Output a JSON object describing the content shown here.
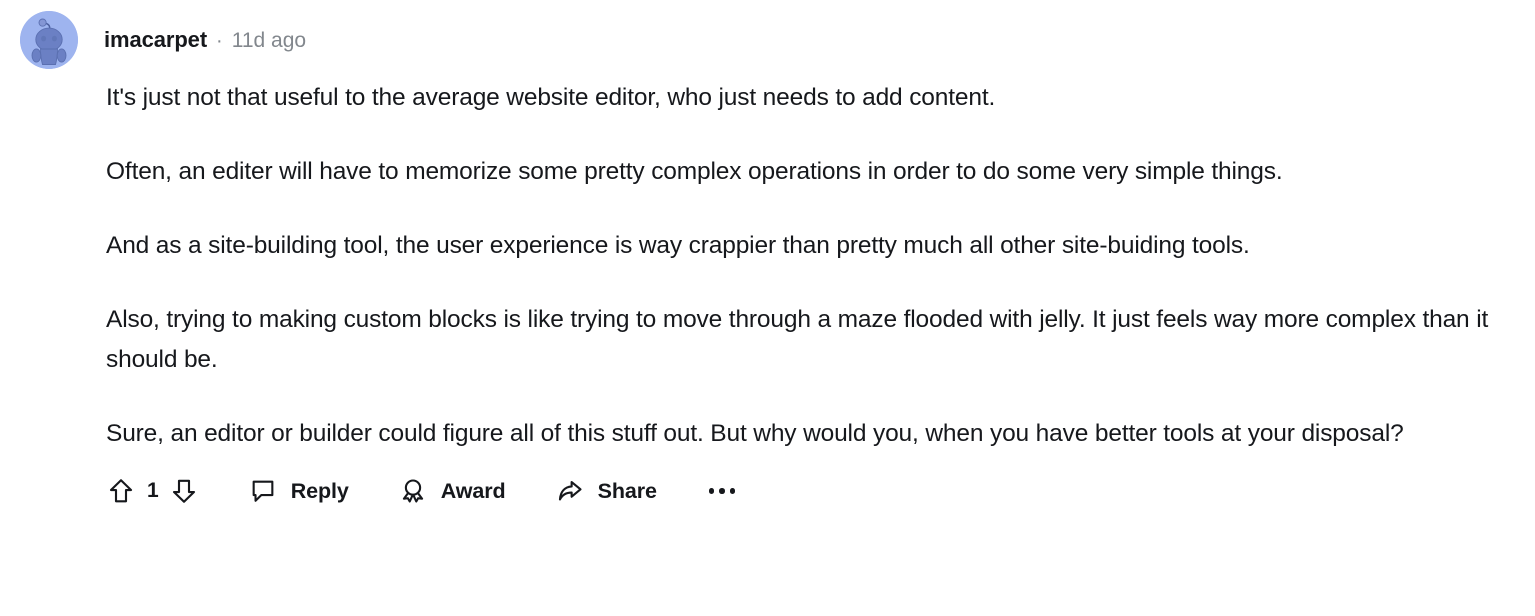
{
  "comment": {
    "author": {
      "username": "imacarpet",
      "avatar_icon": "reddit-snoo-avatar",
      "avatar_bg_color": "#9eb4ef",
      "avatar_fg_color": "#6b80c4"
    },
    "separator": "·",
    "timestamp": "11d ago",
    "paragraphs": [
      "It's just not that useful to the average website editor, who just needs to add content.",
      "Often, an editer will have to memorize some pretty complex operations in order to do some very simple things.",
      "And as a site-building tool, the user experience is way crappier than pretty much all other site-buiding tools.",
      "Also, trying to making custom blocks is like trying to move through a maze flooded with jelly. It just feels way more complex than it should be.",
      "Sure, an editor or builder could figure all of this stuff out. But why would you, when you have better tools at your disposal?"
    ],
    "actions": {
      "upvote_icon": "upvote-arrow-icon",
      "vote_count": "1",
      "downvote_icon": "downvote-arrow-icon",
      "reply_icon": "comment-bubble-icon",
      "reply_label": "Reply",
      "award_icon": "award-medal-icon",
      "award_label": "Award",
      "share_icon": "share-arrow-icon",
      "share_label": "Share",
      "overflow_icon": "more-options-icon"
    }
  },
  "colors": {
    "text": "#16181c",
    "muted": "#82878d",
    "background": "#ffffff"
  }
}
